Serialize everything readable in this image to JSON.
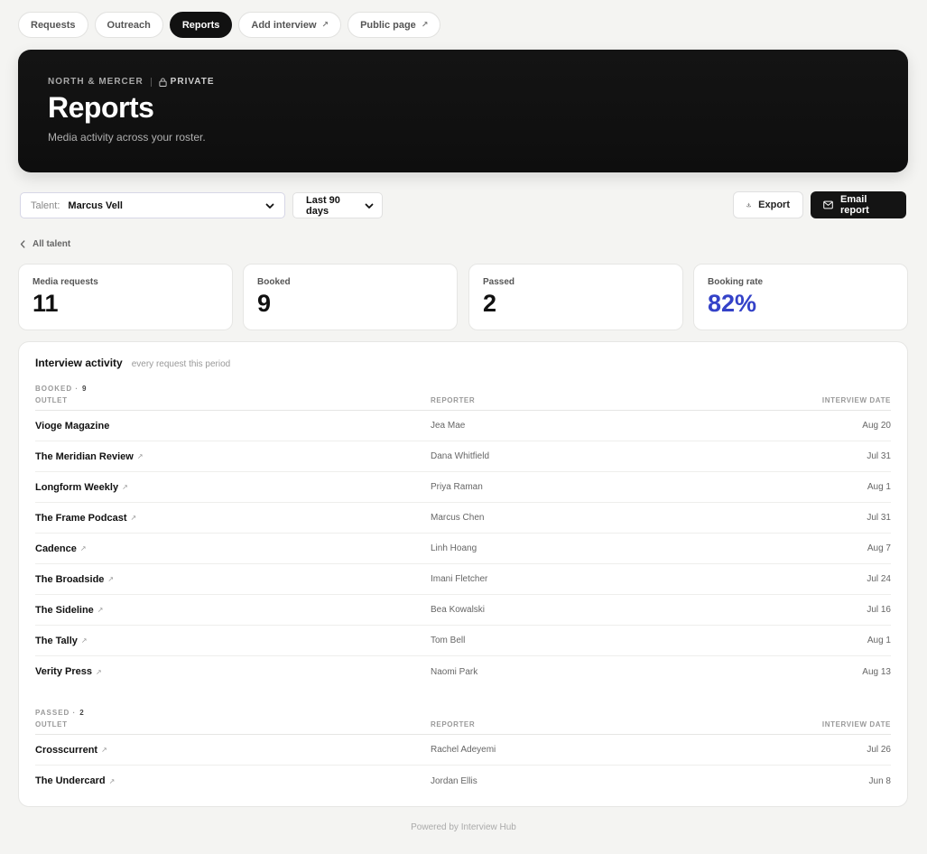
{
  "tabs": [
    {
      "label": "Requests",
      "external": false,
      "active": false
    },
    {
      "label": "Outreach",
      "external": false,
      "active": false
    },
    {
      "label": "Reports",
      "external": false,
      "active": true
    },
    {
      "label": "Add interview",
      "external": true,
      "active": false
    },
    {
      "label": "Public page",
      "external": true,
      "active": false
    }
  ],
  "hero": {
    "org": "NORTH & MERCER",
    "visibility": "PRIVATE",
    "title": "Reports",
    "subtitle": "Media activity across your roster."
  },
  "filters": {
    "talent_label": "Talent:",
    "talent_value": "Marcus Vell",
    "period_value": "Last 90 days"
  },
  "actions": {
    "export_label": "Export",
    "email_label": "Email report"
  },
  "back_link": "All talent",
  "stats": [
    {
      "label": "Media requests",
      "value": "11",
      "accent": false
    },
    {
      "label": "Booked",
      "value": "9",
      "accent": false
    },
    {
      "label": "Passed",
      "value": "2",
      "accent": false
    },
    {
      "label": "Booking rate",
      "value": "82%",
      "accent": true
    }
  ],
  "activity": {
    "title": "Interview activity",
    "subtitle": "every request this period",
    "columns": {
      "outlet": "OUTLET",
      "reporter": "REPORTER",
      "date": "INTERVIEW DATE"
    },
    "booked": {
      "label": "BOOKED ·",
      "count": "9",
      "rows": [
        {
          "outlet": "Vioge Magazine",
          "external": false,
          "reporter": "Jea Mae",
          "date": "Aug 20"
        },
        {
          "outlet": "The Meridian Review",
          "external": true,
          "reporter": "Dana Whitfield",
          "date": "Jul 31"
        },
        {
          "outlet": "Longform Weekly",
          "external": true,
          "reporter": "Priya Raman",
          "date": "Aug 1"
        },
        {
          "outlet": "The Frame Podcast",
          "external": true,
          "reporter": "Marcus Chen",
          "date": "Jul 31"
        },
        {
          "outlet": "Cadence",
          "external": true,
          "reporter": "Linh Hoang",
          "date": "Aug 7"
        },
        {
          "outlet": "The Broadside",
          "external": true,
          "reporter": "Imani Fletcher",
          "date": "Jul 24"
        },
        {
          "outlet": "The Sideline",
          "external": true,
          "reporter": "Bea Kowalski",
          "date": "Jul 16"
        },
        {
          "outlet": "The Tally",
          "external": true,
          "reporter": "Tom Bell",
          "date": "Aug 1"
        },
        {
          "outlet": "Verity Press",
          "external": true,
          "reporter": "Naomi Park",
          "date": "Aug 13"
        }
      ]
    },
    "passed": {
      "label": "PASSED ·",
      "count": "2",
      "rows": [
        {
          "outlet": "Crosscurrent",
          "external": true,
          "reporter": "Rachel Adeyemi",
          "date": "Jul 26"
        },
        {
          "outlet": "The Undercard",
          "external": true,
          "reporter": "Jordan Ellis",
          "date": "Jun 8"
        }
      ]
    }
  },
  "footer": "Powered by Interview Hub",
  "colors": {
    "accent": "#3442c8",
    "dark": "#141414",
    "background": "#f4f4f2"
  }
}
